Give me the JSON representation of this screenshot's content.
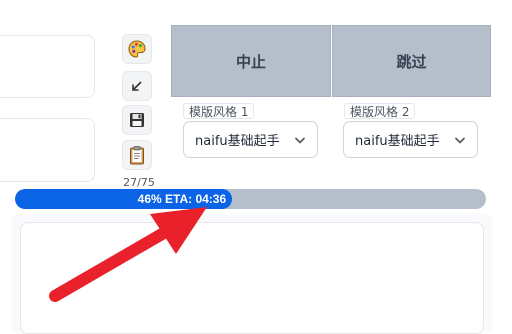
{
  "icons": {
    "palette": "palette-icon",
    "send": "send-arrow-icon",
    "save": "save-icon",
    "clipboard": "clipboard-icon",
    "chevron": "chevron-down-icon"
  },
  "counter": "27/75",
  "actions": {
    "stop_label": "中止",
    "skip_label": "跳过"
  },
  "template_style_1": {
    "label": "模版风格 1",
    "selected": "naifu基础起手"
  },
  "template_style_2": {
    "label": "模版风格 2",
    "selected": "naifu基础起手"
  },
  "progress": {
    "percent": 46,
    "text": "46% ETA: 04:36"
  },
  "colors": {
    "progress_fill": "#0b63e6",
    "progress_track": "#b5bfcb",
    "action_button_bg": "#b5bfcb",
    "annotation_arrow": "#e8212b"
  }
}
